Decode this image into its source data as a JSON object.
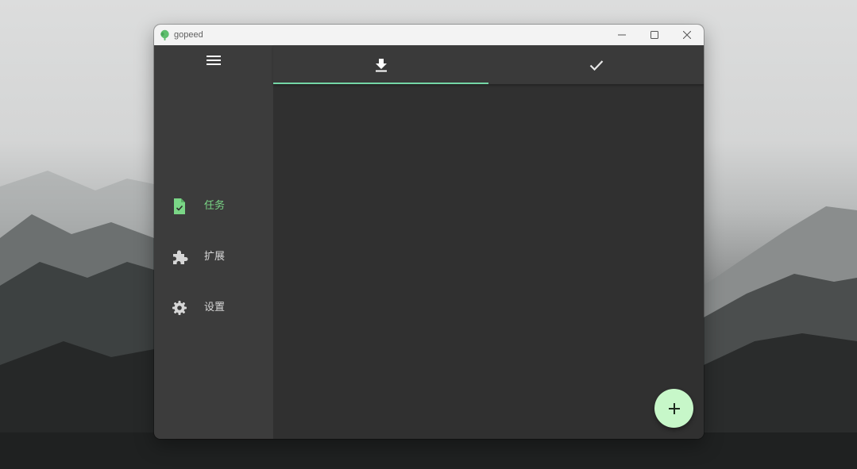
{
  "window": {
    "title": "gopeed",
    "controls": [
      "minimize-icon",
      "maximize-icon",
      "close-icon"
    ]
  },
  "sidebar": {
    "menu_icon": "hamburger-menu-icon",
    "items": [
      {
        "label": "任务",
        "icon": "task-file-icon",
        "active": true
      },
      {
        "label": "扩展",
        "icon": "puzzle-extension-icon",
        "active": false
      },
      {
        "label": "设置",
        "icon": "gear-settings-icon",
        "active": false
      }
    ]
  },
  "tabs": [
    {
      "icon": "download-icon",
      "selected": true
    },
    {
      "icon": "check-done-icon",
      "selected": false
    }
  ],
  "fab": {
    "icon": "plus-icon"
  },
  "colors": {
    "accent": "#7ad686",
    "tab_indicator": "#74d6a6",
    "fab_bg": "#c7f7c9",
    "sidebar_bg": "#3c3c3c",
    "content_bg": "#303030"
  }
}
